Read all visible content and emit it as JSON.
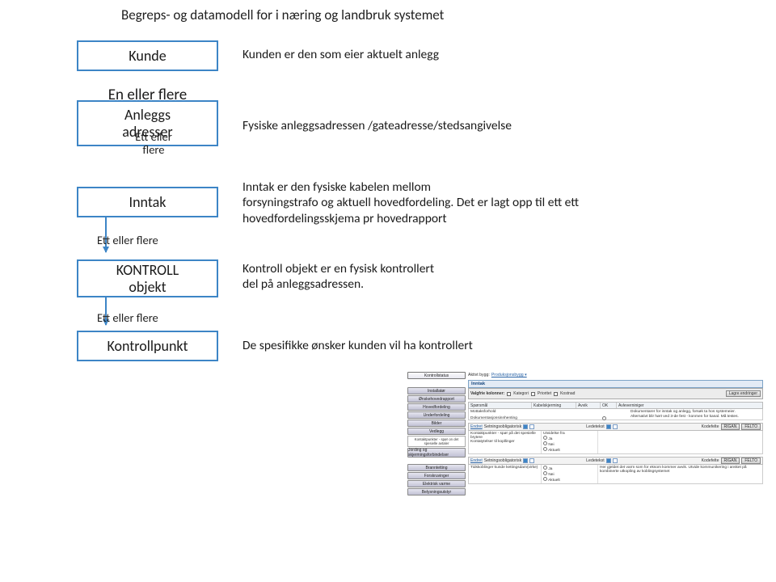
{
  "title": "Begreps- og datamodell for i næring og landbruk systemet",
  "boxes": {
    "kunde": "Kunde",
    "anleggs_l1": "Anleggs",
    "anleggs_l2": "adresser",
    "inntak": "Inntak",
    "kontroll_l1": "KONTROLL",
    "kontroll_l2": "objekt",
    "kontrollpunkt": "Kontrollpunkt"
  },
  "labels": {
    "en_eller_flere": "En eller flere",
    "ett_eller_flere_anleggs_l1": "Ett eller",
    "ett_eller_flere_anleggs_l2": "flere",
    "ett_eller_flere_inntak": "Ett eller flere",
    "ett_eller_flere_kontroll": "Ett eller flere"
  },
  "desc": {
    "kunde": "Kunden er den som  eier aktuelt anlegg",
    "fysiske": "Fysiske anleggsadressen /gateadresse/stedsangivelse",
    "inntak": "Inntak er den fysiske kabelen mellom\n forsyningstrafo og aktuell hovedfordeling. Det er lagt opp til ett ett hovedfordelingsskjema pr hovedrapport",
    "kontroll": "Kontroll objekt er en fysisk kontrollert\ndel på anleggsadressen.",
    "kontrollpunkt": "De spesifikke ønsker kunden vil ha kontrollert"
  },
  "sw": {
    "tabs": [
      "Kontrollstatus"
    ],
    "right_tab_l": "Aktivt bygg:",
    "right_tab_v": "Produksjonsbygg ▾",
    "panel": "Inntak",
    "left_buttons": [
      "Installatør",
      "Ønskehovedrapport",
      "Hovedfordeling",
      "Underfordeling",
      "Bilder",
      "Vedlegg"
    ],
    "left_txt_1_l1": "Kontaktpunkter - spør on det",
    "left_txt_1_l2": "spesielle avtaler",
    "left_buttons2": [
      "Jording og skjermingsforbindelser"
    ],
    "left_buttons3": [
      "Branntetting",
      "Forskruvinger",
      "Elektrisk varme",
      "Belysningsutstyr"
    ],
    "valgfrie": "Valgfrie kolonner:",
    "chk": [
      "Kategori",
      "Prioritet",
      "Kostnad"
    ],
    "lagre": "Lagre endringer",
    "th": {
      "sporsmal": "Spørsmål",
      "kabelskjerming": "Kabelskjerming",
      "avvik": "Avvik",
      "ok": "OK",
      "avlevesterninger": "Avleverniniger"
    },
    "cell_l1": "Mottaksforhold",
    "cell_l2": "Dokumentasjonsinnhenting",
    "ar_l1": "Dokumentarer for inntak og anlegg, forsøk ta hos systemeier.",
    "ar_l2": "Alternativt blir hørt ved 3-de fest - konmen for kanal. Må testes.",
    "endret": "Endret",
    "settningsoblig": "Setningsobligatorisk",
    "ledetekst": "Ledetekst",
    "kodefelte": "Kodefelte",
    "riggan": "RIGAN",
    "felto": "FELTO",
    "sub_q1": "Kontaktpunkter - spør på det spesielle brytere",
    "sub_q2": "Kontatytelser til kopllinger",
    "sub_q3": "Tidskoblinger kunde kettingsdam(virke)",
    "mod": "Utvidelse fra",
    "ja": "Ja",
    "nei": "Nei",
    "aktuelt": "Aktuelt",
    "rtxt": "Her gjeldet det varm som for eksom kommer avvik. Utvide kommunikering i ansket på kombinerte utkopling av koblingsystemet"
  }
}
